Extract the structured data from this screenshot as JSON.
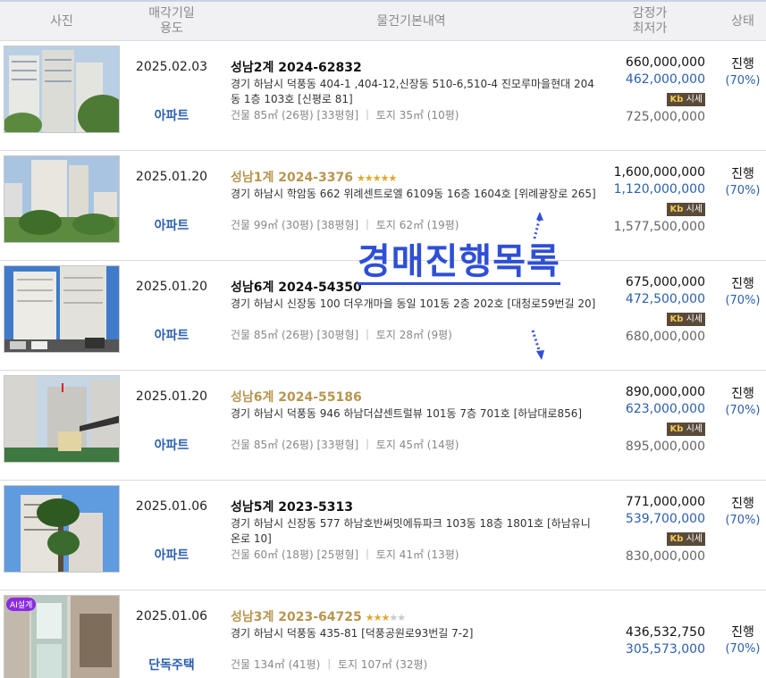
{
  "header": {
    "photo": "사진",
    "date_line1": "매각기일",
    "date_line2": "용도",
    "info": "물건기본내역",
    "price_line1": "감정가",
    "price_line2": "최저가",
    "status": "상태"
  },
  "kb_label": "시세",
  "kb_logo": "Kb",
  "overlay_text": "경매진행목록",
  "rows": [
    {
      "date": "2025.02.03",
      "usage": "아파트",
      "case": "성남2계 2024-62832",
      "gold": false,
      "stars": 0,
      "addr": "경기 하남시 덕풍동 404-1 ,404-12,신장동 510-6,510-4 진모루마을현대 204동 1층 103호 [신평로 81]",
      "area": "건물 85㎡ (26평) [33평형]  ｜  토지 35㎡ (10평)",
      "appraisal": "660,000,000",
      "minimum": "462,000,000",
      "market": "725,000,000",
      "status": "진행",
      "pct": "(70%)"
    },
    {
      "date": "2025.01.20",
      "usage": "아파트",
      "case": "성남1계 2024-3376",
      "gold": true,
      "stars": 5,
      "addr": "경기 하남시 학암동 662 위례센트로엘 6109동 16층 1604호 [위례광장로 265]",
      "area": "건물 99㎡ (30평) [38평형]  ｜  토지 62㎡ (19평)",
      "appraisal": "1,600,000,000",
      "minimum": "1,120,000,000",
      "market": "1,577,500,000",
      "status": "진행",
      "pct": "(70%)"
    },
    {
      "date": "2025.01.20",
      "usage": "아파트",
      "case": "성남6계 2024-54350",
      "gold": false,
      "stars": 0,
      "addr": "경기 하남시 신장동 100 더우개마을 동일 101동 2층 202호 [대청로59번길 20]",
      "area": "건물 85㎡ (26평) [30평형]  ｜  토지 28㎡ (9평)",
      "appraisal": "675,000,000",
      "minimum": "472,500,000",
      "market": "680,000,000",
      "status": "진행",
      "pct": "(70%)"
    },
    {
      "date": "2025.01.20",
      "usage": "아파트",
      "case": "성남6계 2024-55186",
      "gold": true,
      "stars": 0,
      "addr": "경기 하남시 덕풍동 946 하남더샵센트럴뷰 101동 7층 701호 [하남대로856]",
      "area": "건물 85㎡ (26평) [33평형]  ｜  토지 45㎡ (14평)",
      "appraisal": "890,000,000",
      "minimum": "623,000,000",
      "market": "895,000,000",
      "status": "진행",
      "pct": "(70%)"
    },
    {
      "date": "2025.01.06",
      "usage": "아파트",
      "case": "성남5계 2023-5313",
      "gold": false,
      "stars": 0,
      "addr": "경기 하남시 신장동 577 하남호반써밋에듀파크 103동 18층 1801호 [하남유니온로 10]",
      "area": "건물 60㎡ (18평) [25평형]  ｜  토지 41㎡ (13평)",
      "appraisal": "771,000,000",
      "minimum": "539,700,000",
      "market": "830,000,000",
      "status": "진행",
      "pct": "(70%)"
    },
    {
      "date": "2025.01.06",
      "usage": "단독주택",
      "case": "성남3계 2023-64725",
      "gold": true,
      "stars": 3,
      "addr": "경기 하남시 덕풍동 435-81 [덕풍공원로93번길 7-2]",
      "area": "건물 134㎡ (41평)  ｜  토지 107㎡ (32평)",
      "appraisal": "436,532,750",
      "minimum": "305,573,000",
      "market": "",
      "status": "진행",
      "pct": "(70%)",
      "badge": "AI설계"
    }
  ]
}
